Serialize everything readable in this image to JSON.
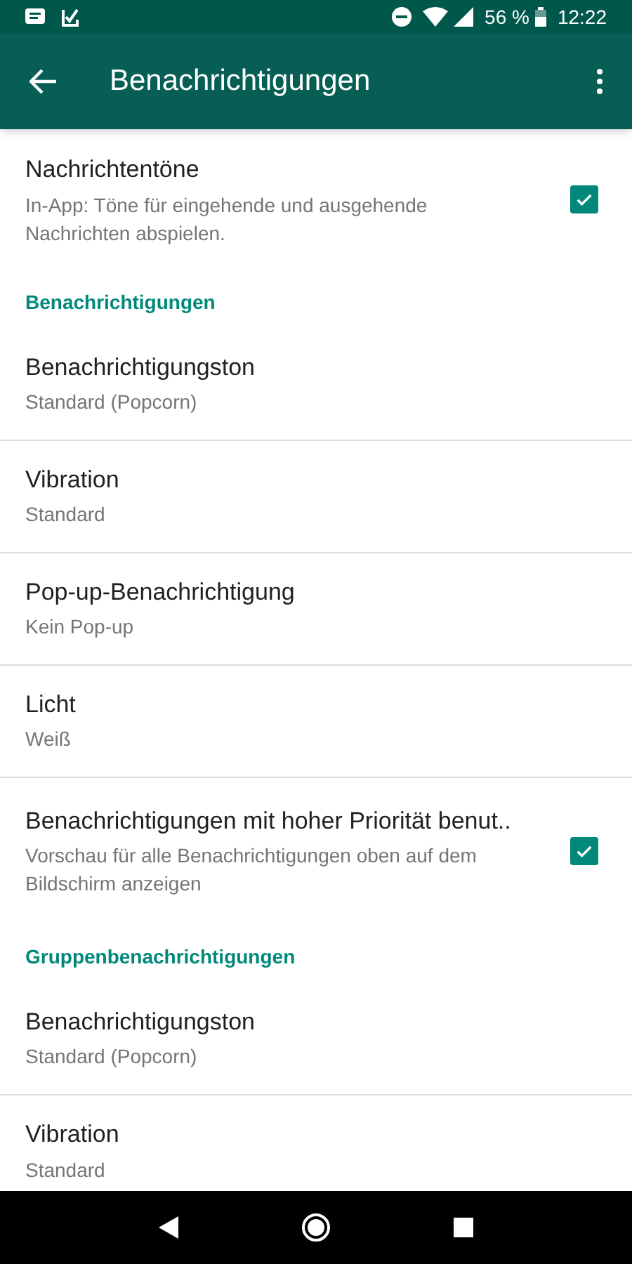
{
  "status_bar": {
    "battery": "56 %",
    "time": "12:22"
  },
  "app_bar": {
    "title": "Benachrichtigungen"
  },
  "items": [
    {
      "kind": "checkbox",
      "title": "Nachrichtentöne",
      "summary": "In-App: Töne für eingehende und ausgehende Nachrichten abspielen.",
      "checked": true
    },
    {
      "kind": "section",
      "title": "Benachrichtigungen"
    },
    {
      "kind": "setting",
      "title": "Benachrichtigungston",
      "summary": "Standard (Popcorn)"
    },
    {
      "kind": "setting",
      "title": "Vibration",
      "summary": "Standard"
    },
    {
      "kind": "setting",
      "title": "Pop-up-Benachrichtigung",
      "summary": "Kein Pop-up"
    },
    {
      "kind": "setting",
      "title": "Licht",
      "summary": "Weiß"
    },
    {
      "kind": "checkbox",
      "title": "Benachrichtigungen mit hoher Priorität benut..",
      "summary": "Vorschau für alle Benachrichtigungen oben auf dem Bildschirm anzeigen",
      "checked": true
    },
    {
      "kind": "section",
      "title": "Gruppenbenachrichtigungen"
    },
    {
      "kind": "setting",
      "title": "Benachrichtigungston",
      "summary": "Standard (Popcorn)"
    },
    {
      "kind": "setting",
      "title": "Vibration",
      "summary": "Standard"
    }
  ]
}
